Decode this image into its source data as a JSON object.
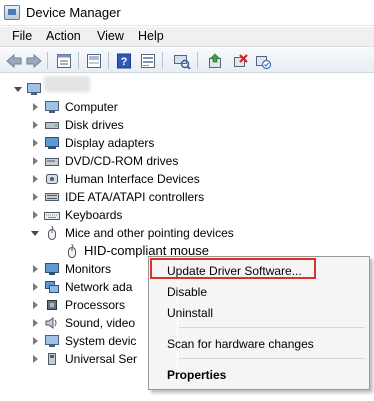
{
  "window": {
    "title": "Device Manager"
  },
  "menu": {
    "file": "File",
    "action": "Action",
    "view": "View",
    "help": "Help"
  },
  "toolbar": {
    "buttons": [
      "back-arrow-icon",
      "forward-arrow-icon",
      "properties-icon",
      "show-hide-icon",
      "help-icon",
      "devices-icon",
      "scan-icon",
      "update-driver-icon",
      "uninstall-icon",
      "enable-icon"
    ]
  },
  "tree": {
    "root_label": "",
    "items": [
      {
        "label": "Computer",
        "icon": "computer-icon",
        "expanded": false
      },
      {
        "label": "Disk drives",
        "icon": "disk-drive-icon",
        "expanded": false
      },
      {
        "label": "Display adapters",
        "icon": "display-adapter-icon",
        "expanded": false
      },
      {
        "label": "DVD/CD-ROM drives",
        "icon": "dvd-drive-icon",
        "expanded": false
      },
      {
        "label": "Human Interface Devices",
        "icon": "hid-icon",
        "expanded": false
      },
      {
        "label": "IDE ATA/ATAPI controllers",
        "icon": "ide-controller-icon",
        "expanded": false
      },
      {
        "label": "Keyboards",
        "icon": "keyboard-icon",
        "expanded": false
      },
      {
        "label": "Mice and other pointing devices",
        "icon": "mouse-icon",
        "expanded": true
      },
      {
        "label": "HID-compliant mouse",
        "icon": "mouse-icon",
        "child": true,
        "selected": true
      },
      {
        "label": "Monitors",
        "icon": "monitor-icon",
        "expanded": false
      },
      {
        "label": "Network ada",
        "icon": "network-adapter-icon",
        "expanded": false
      },
      {
        "label": "Processors",
        "icon": "processor-icon",
        "expanded": false
      },
      {
        "label": "Sound, video",
        "icon": "sound-icon",
        "expanded": false
      },
      {
        "label": "System devic",
        "icon": "system-device-icon",
        "expanded": false
      },
      {
        "label": "Universal Ser",
        "icon": "usb-icon",
        "expanded": false
      }
    ]
  },
  "context_menu": {
    "update_driver": "Update Driver Software...",
    "disable": "Disable",
    "uninstall": "Uninstall",
    "scan": "Scan for hardware changes",
    "properties": "Properties"
  },
  "colors": {
    "highlight_border": "#e0302a",
    "selection": "#3399ff"
  }
}
